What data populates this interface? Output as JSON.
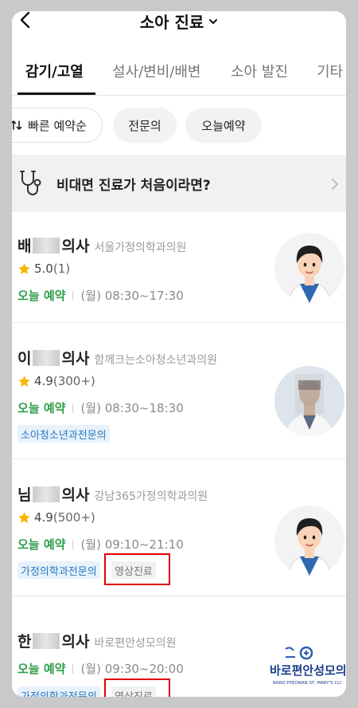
{
  "header": {
    "title": "소아 진료"
  },
  "tabs": [
    {
      "label": "감기/고열",
      "active": true
    },
    {
      "label": "설사/변비/배변",
      "active": false
    },
    {
      "label": "소아 발진",
      "active": false
    },
    {
      "label": "기타 소",
      "active": false
    }
  ],
  "filters": {
    "sort": "빠른 예약순",
    "specialist": "전문의",
    "today": "오늘예약"
  },
  "banner": {
    "text": "비대면 진료가 처음이라면?"
  },
  "doctors": [
    {
      "name_initial": "배",
      "title": "의사",
      "hospital": "서울가정의학과의원",
      "rating": "5.0",
      "rating_count": "(1)",
      "availability": "오늘 예약",
      "hours": "(월) 08:30~17:30",
      "tags": [],
      "avatar": "cartoon-doctor-female"
    },
    {
      "name_initial": "이",
      "title": "의사",
      "hospital": "함께크는소아청소년과의원",
      "rating": "4.9",
      "rating_count": "(300+)",
      "availability": "오늘 예약",
      "hours": "(월) 08:30~18:30",
      "tags": [
        "소아청소년과전문의"
      ],
      "avatar": "photo-doctor"
    },
    {
      "name_initial": "님",
      "title": "의사",
      "hospital": "강남365가정의학과의원",
      "rating": "4.9",
      "rating_count": "(500+)",
      "availability": "오늘 예약",
      "hours": "(월) 09:10~21:10",
      "tags": [
        "가정의학과전문의",
        "영상진료"
      ],
      "avatar": "cartoon-doctor-female"
    },
    {
      "name_initial": "한",
      "title": "의사",
      "hospital": "바로편안성모의원",
      "availability": "오늘 예약",
      "hours": "(월) 09:30~20:00",
      "tags": [
        "가정의학과전문의",
        "영상진료"
      ],
      "logo_text": "바로편안성모의",
      "logo_subtext": "BARO PYEONAN ST. MARY'S CLI"
    }
  ],
  "colors": {
    "available_green": "#2e9e48",
    "tag_blue": "#2a78c0",
    "highlight_red": "#e30000",
    "star_yellow": "#f7b500"
  }
}
